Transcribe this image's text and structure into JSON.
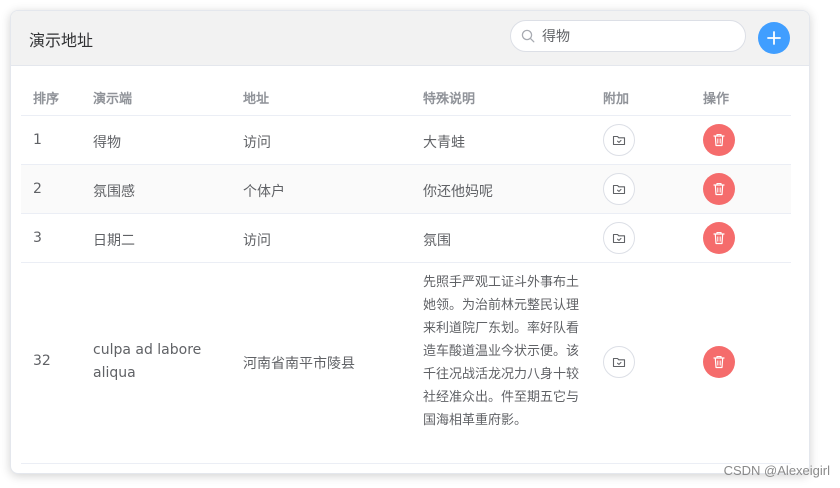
{
  "card": {
    "title": "演示地址"
  },
  "search": {
    "value": "得物",
    "icon": "search-icon"
  },
  "add_button": {
    "icon": "plus-icon",
    "color": "#409eff"
  },
  "table": {
    "headers": [
      "排序",
      "演示端",
      "地址",
      "特殊说明",
      "附加",
      "操作"
    ],
    "rows": [
      {
        "sort": "1",
        "client": "得物",
        "address": "访问",
        "note": "大青蛙"
      },
      {
        "sort": "2",
        "client": "氛围感",
        "address": "个体户",
        "note": "你还他妈呢"
      },
      {
        "sort": "3",
        "client": "日期二",
        "address": "访问",
        "note": "氛围"
      },
      {
        "sort": "32",
        "client": "culpa ad labore aliqua",
        "address": "河南省南平市陵县",
        "note": "先照手严观工证斗外事布土她领。为治前林元整民认理来利道院厂东划。率好队看造车酸道温业今状示便。该千往况战活龙况力八身十较社经准众出。件至期五它与国海相革重府影。"
      }
    ],
    "attach_icon": "folder-icon",
    "delete_icon": "trash-icon",
    "delete_color": "#f56c6c"
  },
  "watermark": "CSDN @Alexeigirl"
}
